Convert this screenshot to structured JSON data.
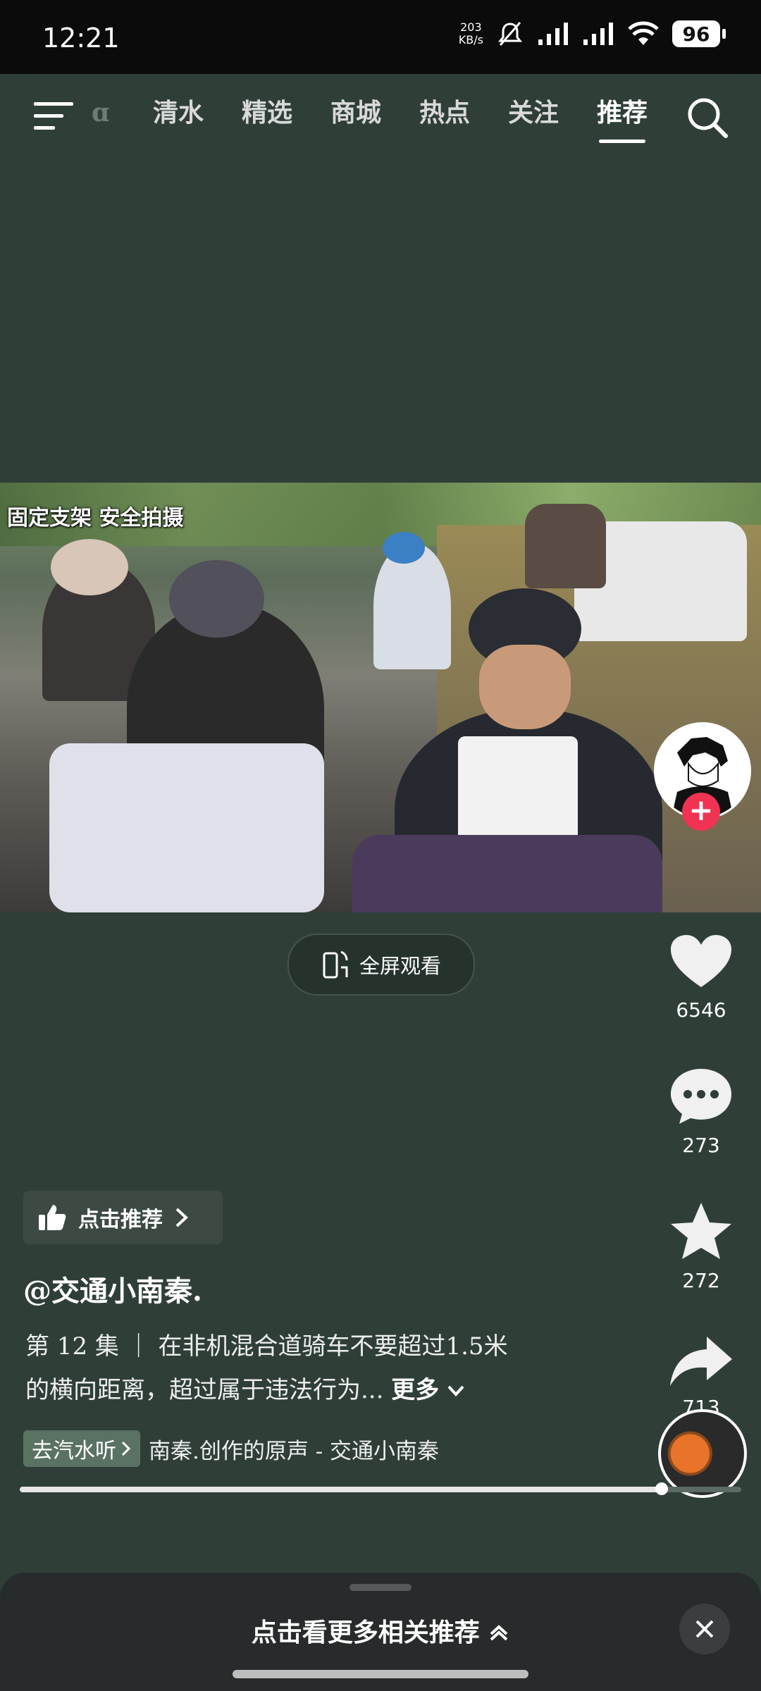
{
  "status_bar": {
    "time": "12:21",
    "net_speed_value": "203",
    "net_speed_unit": "KB/s",
    "battery": "96"
  },
  "top_nav": {
    "tabs": [
      "ɑ",
      "清水",
      "精选",
      "商城",
      "热点",
      "关注",
      "推荐"
    ],
    "active_tab": "推荐"
  },
  "video": {
    "watermark": "固定支架 安全拍摄",
    "fullscreen_label": "全屏观看"
  },
  "side_actions": {
    "like_count": "6546",
    "comment_count": "273",
    "favorite_count": "272",
    "share_count": "713"
  },
  "info": {
    "recommend_chip": "点击推荐",
    "author": "@交通小南秦.",
    "description_line1": "第 12 集 ｜ 在非机混合道骑车不要超过1.5米",
    "description_line2": "的横向距离，超过属于违法行为...",
    "more_label": "更多",
    "music_tag": "去汽水听",
    "music_text": "南秦.创作的原声 - 交通小南秦"
  },
  "progress": {
    "fraction": 0.89
  },
  "bottom_sheet": {
    "label": "点击看更多相关推荐"
  },
  "colors": {
    "background": "#2f3f38",
    "follow_accent": "#f03353"
  }
}
